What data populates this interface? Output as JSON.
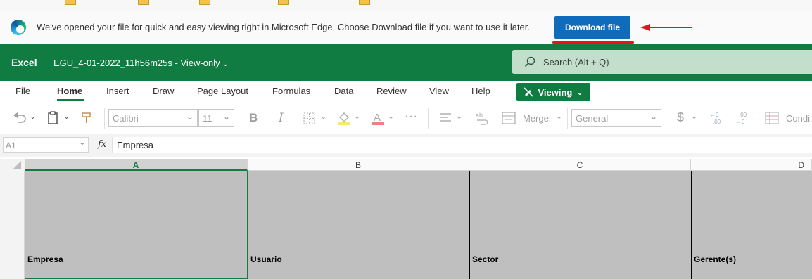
{
  "edge_bar": {
    "message": "We've opened your file for quick and easy viewing right in Microsoft Edge. Choose Download file if you want to use it later.",
    "download_label": "Download file"
  },
  "excel_header": {
    "brand": "Excel",
    "filename": "EGU_4-01-2022_11h56m25s",
    "mode": "View-only",
    "search_placeholder": "Search (Alt + Q)"
  },
  "menu": {
    "tabs": [
      "File",
      "Home",
      "Insert",
      "Draw",
      "Page Layout",
      "Formulas",
      "Data",
      "Review",
      "View",
      "Help"
    ],
    "active_tab": "Home",
    "viewing_label": "Viewing"
  },
  "toolbar": {
    "font_name": "Calibri",
    "font_size": "11",
    "bold_label": "B",
    "italic_label": "I",
    "merge_label": "Merge",
    "number_format": "General",
    "currency_label": "$",
    "conditional_label": "Condi"
  },
  "formula_bar": {
    "name_box": "A1",
    "fx_label": "fx",
    "value": "Empresa"
  },
  "grid": {
    "columns": [
      "A",
      "B",
      "C",
      "D"
    ],
    "selected_column": "A",
    "row1": [
      "Empresa",
      "Usuario",
      "Sector",
      "Gerente(s)"
    ]
  },
  "colors": {
    "excel_green": "#107c41",
    "edge_button_blue": "#0f6cbd",
    "annotation_red": "#e81123"
  }
}
